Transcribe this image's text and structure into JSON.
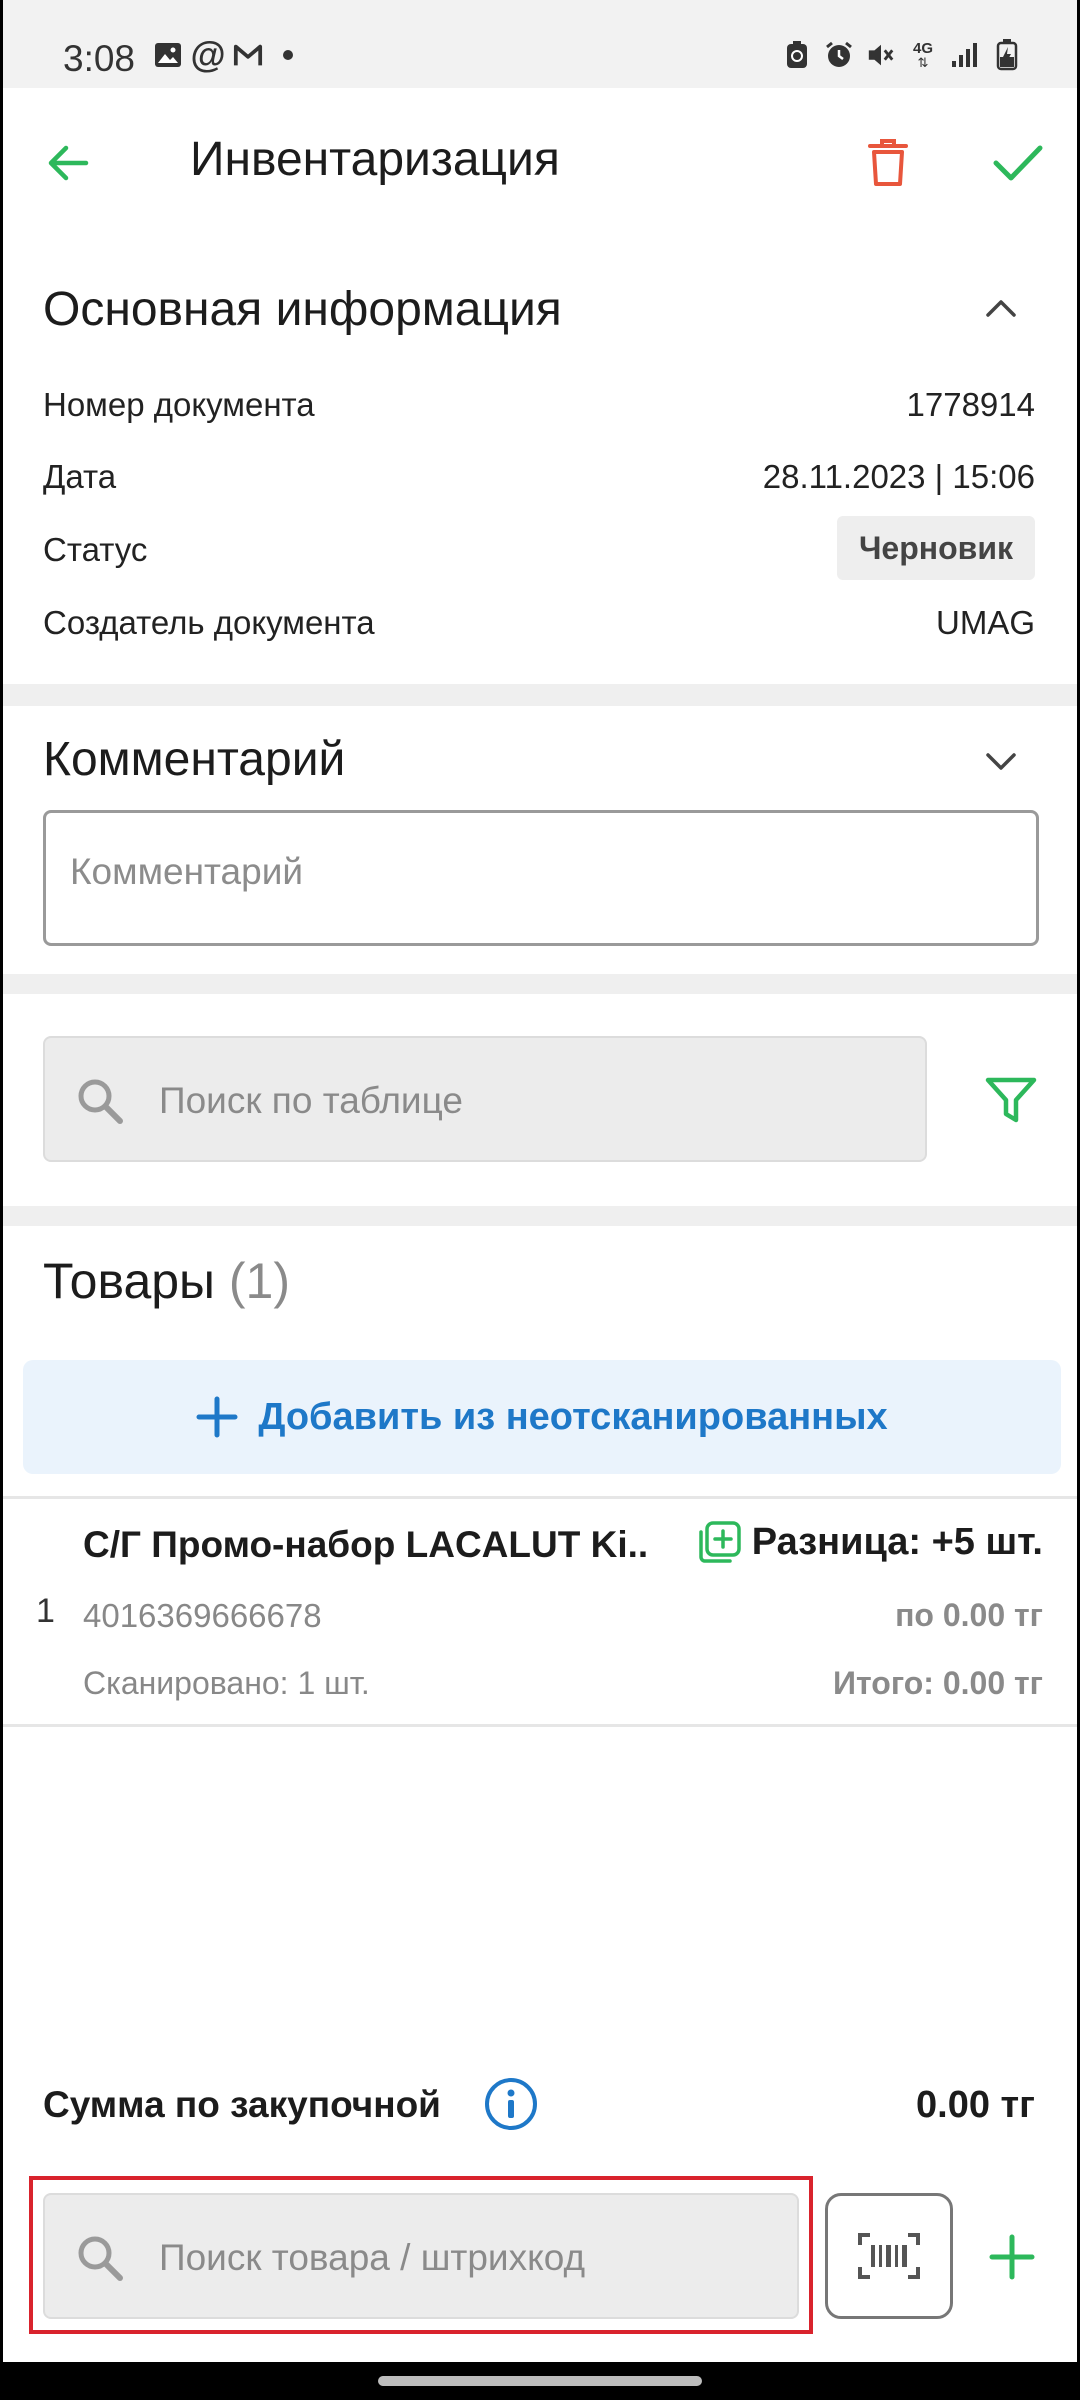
{
  "status_bar": {
    "time": "3:08",
    "network": "4G"
  },
  "app_bar": {
    "title": "Инвентаризация",
    "accent_color": "#2db85b",
    "delete_color": "#e8563c"
  },
  "main_info": {
    "title": "Основная информация",
    "rows": [
      {
        "label": "Номер документа",
        "value": "1778914"
      },
      {
        "label": "Дата",
        "value": "28.11.2023 | 15:06"
      },
      {
        "label": "Статус",
        "value": "Черновик"
      },
      {
        "label": "Создатель документа",
        "value": "UMAG"
      }
    ]
  },
  "comment": {
    "title": "Комментарий",
    "placeholder": "Комментарий"
  },
  "table_search": {
    "placeholder": "Поиск по таблице"
  },
  "goods": {
    "title": "Товары",
    "count": "(1)",
    "add_unscanned_label": "Добавить из неотсканированных",
    "items": [
      {
        "index": "1",
        "name": "С/Г Промо-набор LACALUT Ki..",
        "difference": "Разница: +5 шт.",
        "barcode": "4016369666678",
        "price": "по 0.00 тг",
        "scanned": "Сканировано: 1 шт.",
        "total": "Итого: 0.00 тг"
      }
    ]
  },
  "footer": {
    "sum_label": "Сумма по закупочной",
    "sum_value": "0.00 тг",
    "product_search_placeholder": "Поиск товара / штрихкод"
  }
}
